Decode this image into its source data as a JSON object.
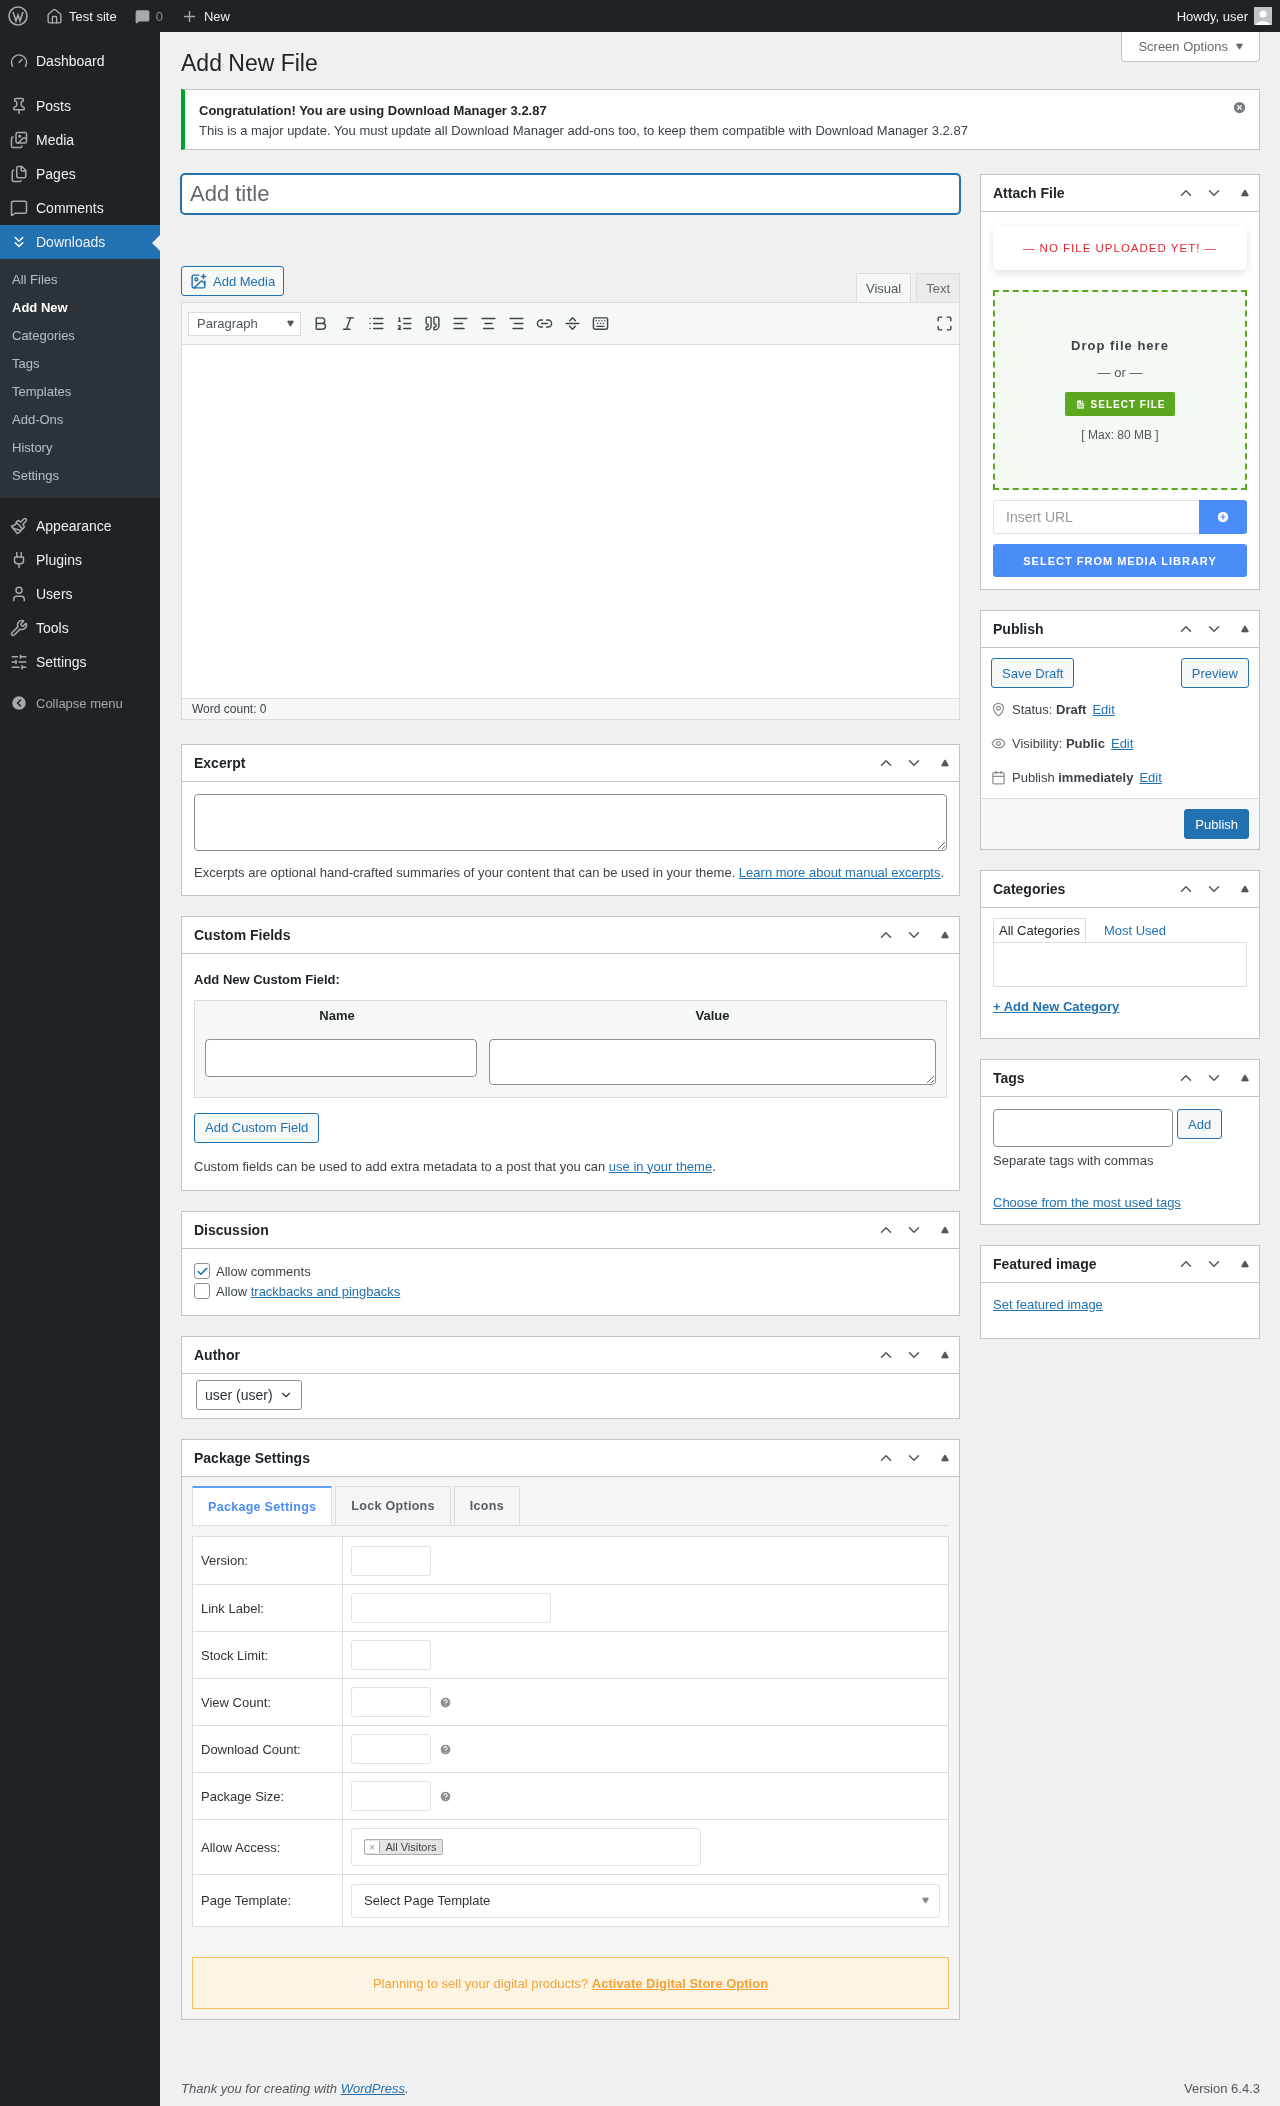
{
  "admin_bar": {
    "site": "Test site",
    "comments": "0",
    "new": "New",
    "greeting": "Howdy, user"
  },
  "menu_groups": [
    [
      {
        "label": "Dashboard",
        "selected": false
      }
    ],
    [
      {
        "label": "Posts",
        "selected": false
      },
      {
        "label": "Media",
        "selected": false
      },
      {
        "label": "Pages",
        "selected": false
      },
      {
        "label": "Comments",
        "selected": false
      },
      {
        "label": "Downloads",
        "selected": true,
        "children": [
          {
            "label": "All Files",
            "selected": false
          },
          {
            "label": "Add New",
            "selected": true
          },
          {
            "label": "Categories",
            "selected": false
          },
          {
            "label": "Tags",
            "selected": false
          },
          {
            "label": "Templates",
            "selected": false
          },
          {
            "label": "Add-Ons",
            "selected": false
          },
          {
            "label": "History",
            "selected": false
          },
          {
            "label": "Settings",
            "selected": false
          }
        ]
      }
    ],
    [
      {
        "label": "Appearance",
        "selected": false
      },
      {
        "label": "Plugins",
        "selected": false
      },
      {
        "label": "Users",
        "selected": false
      },
      {
        "label": "Tools",
        "selected": false
      },
      {
        "label": "Settings",
        "selected": false
      }
    ]
  ],
  "collapse_menu": "Collapse menu",
  "screen_options": "Screen Options",
  "page_title": "Add New File",
  "notice": {
    "title": "Congratulation! You are using Download Manager 3.2.87",
    "text": "This is a major update. You must update all Download Manager add-ons too, to keep them compatible with Download Manager 3.2.87"
  },
  "editor": {
    "title_placeholder": "Add title",
    "add_media": "Add Media",
    "tabs": [
      {
        "label": "Visual",
        "selected": true
      },
      {
        "label": "Text",
        "selected": false
      }
    ],
    "format": "Paragraph",
    "word_count": "Word count: 0"
  },
  "excerpt": {
    "title": "Excerpt",
    "help": "Excerpts are optional hand-crafted summaries of your content that can be used in your theme. ",
    "link": "Learn more about manual excerpts",
    "after": "."
  },
  "custom_fields": {
    "title": "Custom Fields",
    "heading": "Add New Custom Field:",
    "columns": [
      "Name",
      "Value"
    ],
    "button": "Add Custom Field",
    "help": "Custom fields can be used to add extra metadata to a post that you can ",
    "link": "use in your theme",
    "after": "."
  },
  "discussion": {
    "title": "Discussion",
    "options": [
      {
        "label": "Allow comments",
        "checked": true
      },
      {
        "label": "Allow ",
        "link": "trackbacks and pingbacks",
        "checked": false
      }
    ]
  },
  "author": {
    "title": "Author",
    "value": "user (user)"
  },
  "package_settings": {
    "title": "Package Settings",
    "tabs": [
      {
        "label": "Package Settings",
        "selected": true
      },
      {
        "label": "Lock Options",
        "selected": false
      },
      {
        "label": "Icons",
        "selected": false
      }
    ],
    "rows": [
      {
        "label": "Version:",
        "kind": "text"
      },
      {
        "label": "Link Label:",
        "kind": "wide_text"
      },
      {
        "label": "Stock Limit:",
        "kind": "text"
      },
      {
        "label": "View Count:",
        "kind": "text_help"
      },
      {
        "label": "Download Count:",
        "kind": "text_help"
      },
      {
        "label": "Package Size:",
        "kind": "text_help"
      },
      {
        "label": "Allow Access:",
        "kind": "tags",
        "tags": [
          {
            "remove": "×",
            "label": "All Visitors"
          }
        ]
      },
      {
        "label": "Page Template:",
        "kind": "select",
        "value": "Select Page Template"
      }
    ],
    "promo": {
      "text": "Planning to sell your digital products? ",
      "link": "Activate Digital Store Option"
    }
  },
  "attach_file": {
    "title": "Attach File",
    "status": "— NO FILE UPLOADED YET! —",
    "drop": "Drop file here",
    "or": "— or —",
    "select_file": "SELECT FILE",
    "max": "[ Max: 80 MB ]",
    "url_placeholder": "Insert URL",
    "media_library": "SELECT FROM MEDIA LIBRARY"
  },
  "publish": {
    "title": "Publish",
    "save_draft": "Save Draft",
    "preview": "Preview",
    "rows": [
      {
        "text": "Status: **Draft**",
        "link": "Edit"
      },
      {
        "text": "Visibility: **Public**",
        "link": "Edit"
      },
      {
        "text": "Publish **immediately**",
        "link": "Edit"
      }
    ],
    "button": "Publish"
  },
  "categories": {
    "title": "Categories",
    "tabs": [
      {
        "label": "All Categories",
        "selected": true
      },
      {
        "label": "Most Used",
        "selected": false
      }
    ],
    "add_link": "+ Add New Category"
  },
  "tags": {
    "title": "Tags",
    "button": "Add",
    "help": "Separate tags with commas",
    "link": "Choose from the most used tags"
  },
  "featured_image": {
    "title": "Featured image",
    "link": "Set featured image"
  },
  "footer": {
    "text": "Thank you for creating with ",
    "link": "WordPress",
    "after": ".",
    "version": "Version 6.4.3"
  }
}
